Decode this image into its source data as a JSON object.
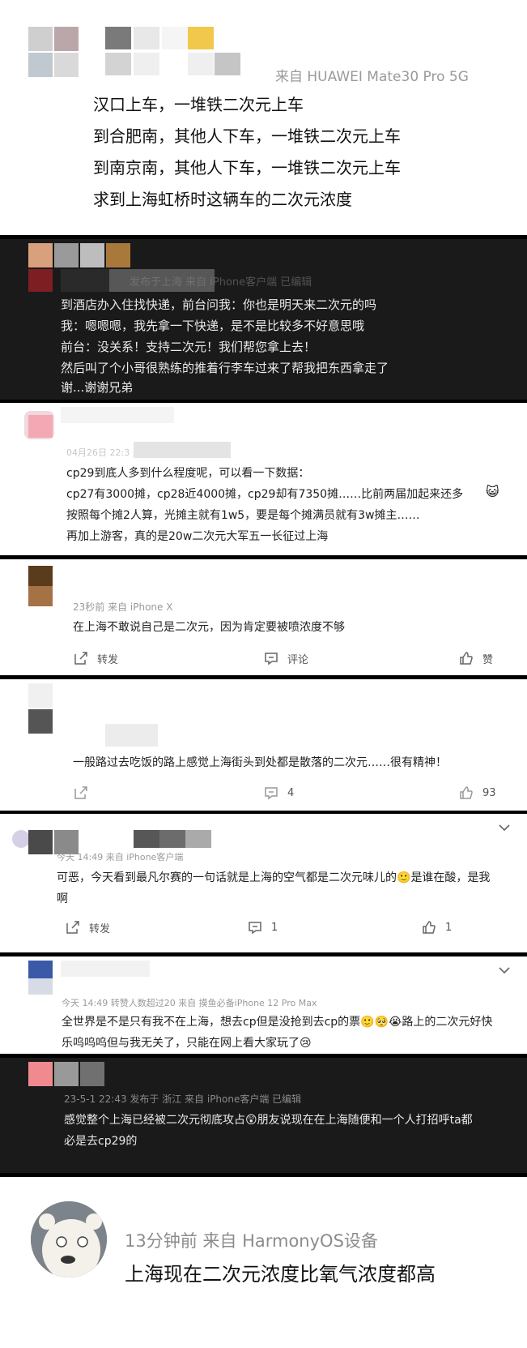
{
  "posts": [
    {
      "source": "来自 HUAWEI Mate30 Pro 5G",
      "lines": [
        "汉口上车，一堆铁二次元上车",
        "到合肥南，其他人下车，一堆铁二次元上车",
        "到南京南，其他人下车，一堆铁二次元上车",
        "求到上海虹桥时这辆车的二次元浓度"
      ]
    },
    {
      "meta": "发布于上海 来自 iPhone客户端 已编辑",
      "lines": [
        "到酒店办入住找快递，前台问我：你也是明天来二次元的吗",
        "我：嗯嗯嗯，我先拿一下快递，是不是比较多不好意思哦",
        "前台：没关系！支持二次元！我们帮您拿上去！",
        "然后叫了个小哥很熟练的推着行李车过来了帮我把东西拿走了",
        "谢...谢谢兄弟"
      ]
    },
    {
      "meta": "04月26日 22:3 来自 iPhone客户端",
      "lines": [
        "cp29到底人多到什么程度呢，可以看一下数据：",
        "cp27有3000摊，cp28近4000摊，cp29却有7350摊……比前两届加起来还多",
        "按照每个摊2人算，光摊主就有1w5，要是每个摊满员就有3w摊主……",
        "再加上游客，真的是20w二次元大军五一长征过上海"
      ]
    },
    {
      "meta": "23秒前  来自 iPhone X",
      "lines": [
        "在上海不敢说自己是二次元，因为肯定要被喷浓度不够"
      ],
      "actions": {
        "repost": "转发",
        "comment": "评论",
        "like": "赞"
      }
    },
    {
      "lines": [
        "一般路过去吃饭的路上感觉上海街头到处都是散落的二次元……很有精神！"
      ],
      "actions": {
        "comment": "4",
        "like": "93"
      }
    },
    {
      "meta": "今天 14:49  来自 iPhone客户端",
      "lines": [
        "可恶，今天看到最凡尔赛的一句话就是上海的空气都是二次元味儿的",
        "是谁在酸，是我",
        "啊"
      ],
      "actions": {
        "repost": "转发",
        "comment": "1",
        "like": "1"
      }
    },
    {
      "meta": "今天 14:49 转赞人数超过20  来自 摸鱼必备iPhone 12 Pro Max",
      "lines": [
        "全世界是不是只有我不在上海，想去cp但是没抢到去cp的票",
        "路上的二次元好快",
        "乐呜呜呜但与我无关了，只能在网上看大家玩了"
      ]
    },
    {
      "meta": "23-5-1 22:43  发布于 浙江  来自 iPhone客户端 已编辑",
      "lines": [
        "感觉整个上海已经被二次元彻底攻占",
        "朋友说现在在上海随便和一个人打招呼ta都",
        "必是去cp29的"
      ]
    },
    {
      "meta": "13分钟前  来自 HarmonyOS设备",
      "lines": [
        "上海现在二次元浓度比氧气浓度都高"
      ]
    }
  ],
  "icons": [
    "share-icon",
    "comment-icon",
    "like-icon",
    "chevron-down-icon",
    "emoji-icon"
  ]
}
